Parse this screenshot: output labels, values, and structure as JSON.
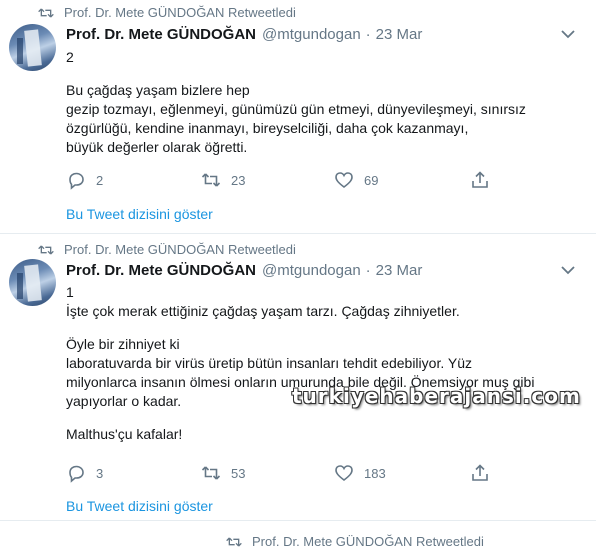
{
  "tweets": [
    {
      "retweet_label": "Prof. Dr. Mete GÜNDOĞAN Retweetledi",
      "author_name": "Prof. Dr. Mete GÜNDOĞAN",
      "handle": "@mtgundogan",
      "separator": "·",
      "date": "23 Mar",
      "lines": [
        "2",
        "",
        "Bu çağdaş yaşam bizlere hep",
        "gezip tozmayı, eğlenmeyi, günümüzü gün etmeyi, dünyevileşmeyi, sınırsız",
        "özgürlüğü, kendine inanmayı, bireyselciliği, daha çok kazanmayı,",
        "büyük değerler olarak öğretti."
      ],
      "replies": "2",
      "retweets": "23",
      "likes": "69",
      "thread_link": "Bu Tweet dizisini göster"
    },
    {
      "retweet_label": "Prof. Dr. Mete GÜNDOĞAN Retweetledi",
      "author_name": "Prof. Dr. Mete GÜNDOĞAN",
      "handle": "@mtgundogan",
      "separator": "·",
      "date": "23 Mar",
      "lines": [
        "1",
        "İşte çok merak ettiğiniz çağdaş yaşam tarzı. Çağdaş zihniyetler.",
        "",
        "Öyle bir zihniyet ki",
        "laboratuvarda bir virüs üretip bütün insanları tehdit edebiliyor. Yüz",
        "milyonlarca insanın ölmesi onların umurunda bile değil. Önemsiyor muş gibi",
        "yapıyorlar o kadar.",
        "",
        "Malthus'çu kafalar!"
      ],
      "replies": "3",
      "retweets": "53",
      "likes": "183",
      "thread_link": "Bu Tweet dizisini göster"
    },
    {
      "retweet_label": "Prof. Dr. Mete GÜNDOĞAN Retweetledi"
    }
  ],
  "watermark": "turkiyehaberajansi.com",
  "icons": {
    "retweet": "retweet-icon",
    "reply": "reply-icon",
    "like": "heart-icon",
    "share": "share-icon",
    "menu": "chevron-down-icon"
  },
  "colors": {
    "link": "#1b95e0",
    "muted": "#657786",
    "text": "#14171a"
  }
}
